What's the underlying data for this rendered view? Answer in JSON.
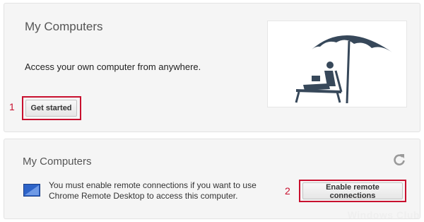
{
  "section_access": {
    "title": "My Computers",
    "description": "Access your own computer from anywhere.",
    "get_started_label": "Get started",
    "annotation_number": "1"
  },
  "section_remote": {
    "title": "My Computers",
    "notice_text": "You must enable remote connections if you want to use Chrome Remote Desktop to access this computer.",
    "enable_label": "Enable remote connections",
    "annotation_number": "2"
  },
  "watermark": "Windows Club",
  "icons": {
    "hero": "beach-umbrella-laptop-illustration",
    "notice": "monitor-icon",
    "refresh": "refresh-icon"
  },
  "colors": {
    "annotation": "#c8102e",
    "illustration": "#37485a",
    "monitor": "#3d6ec9"
  }
}
